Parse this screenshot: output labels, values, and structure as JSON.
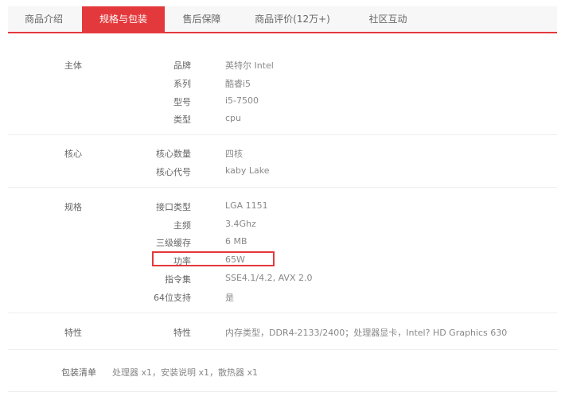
{
  "tabs": [
    {
      "label": "商品介绍",
      "active": false
    },
    {
      "label": "规格与包装",
      "active": true
    },
    {
      "label": "售后保障",
      "active": false
    },
    {
      "label": "商品评价(12万+)",
      "active": false
    },
    {
      "label": "社区互动",
      "active": false
    }
  ],
  "colors": {
    "accent": "#e4393c",
    "text": "#666666",
    "value_text": "#888888"
  },
  "groups": [
    {
      "title": "主体",
      "rows": [
        {
          "key": "品牌",
          "value": "英特尔 Intel"
        },
        {
          "key": "系列",
          "value": "酷睿i5"
        },
        {
          "key": "型号",
          "value": "i5-7500"
        },
        {
          "key": "类型",
          "value": "cpu"
        }
      ]
    },
    {
      "title": "核心",
      "rows": [
        {
          "key": "核心数量",
          "value": "四核"
        },
        {
          "key": "核心代号",
          "value": "kaby Lake"
        }
      ]
    },
    {
      "title": "规格",
      "rows": [
        {
          "key": "接口类型",
          "value": "LGA 1151"
        },
        {
          "key": "主频",
          "value": "3.4Ghz"
        },
        {
          "key": "三级缓存",
          "value": "6 MB"
        },
        {
          "key": "功率",
          "value": "65W",
          "highlighted": true
        },
        {
          "key": "指令集",
          "value": "SSE4.1/4.2, AVX 2.0"
        },
        {
          "key": "64位支持",
          "value": "是"
        }
      ]
    },
    {
      "title": "特性",
      "rows": [
        {
          "key": "特性",
          "value": "内存类型，DDR4-2133/2400；处理器显卡，Intel? HD Graphics 630"
        }
      ]
    }
  ],
  "packing": {
    "label": "包装清单",
    "value": "处理器 x1，安装说明 x1，散热器 x1"
  }
}
